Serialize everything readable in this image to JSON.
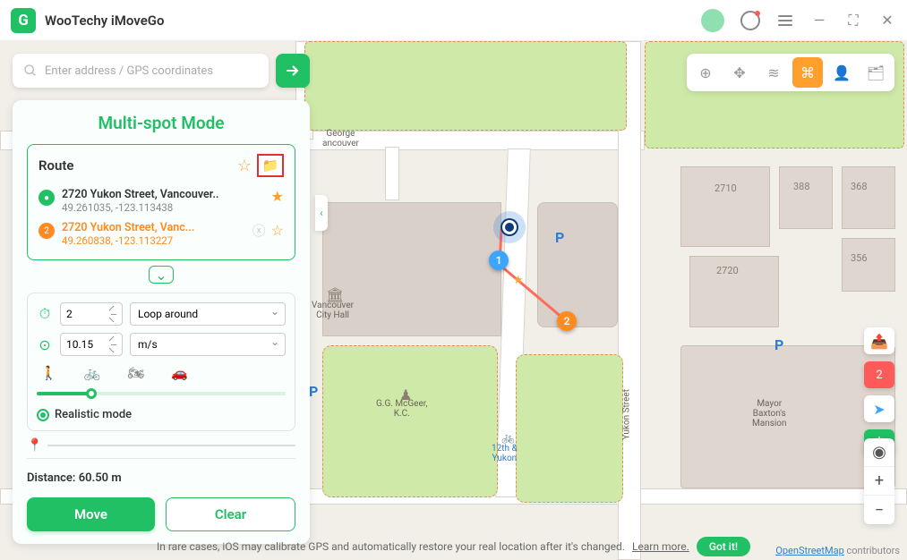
{
  "app": {
    "title": "WooTechy iMoveGo",
    "logo": "G"
  },
  "search": {
    "placeholder": "Enter address / GPS coordinates"
  },
  "mode": {
    "title": "Multi-spot Mode"
  },
  "route": {
    "label": "Route",
    "waypoints": [
      {
        "addr": "2720 Yukon Street, Vancouver..",
        "coord": "49.261035, -123.113438"
      },
      {
        "addr": "2720 Yukon Street, Vanc...",
        "coord": "49.260838, -123.113227"
      }
    ]
  },
  "controls": {
    "repeat": "2",
    "loop_label": "Loop around",
    "speed": "10.15",
    "unit": "m/s",
    "realistic": "Realistic mode"
  },
  "distance": {
    "label": "Distance: 60.50 m"
  },
  "buttons": {
    "move": "Move",
    "clear": "Clear"
  },
  "footer": {
    "text": "In rare cases, iOS may calibrate GPS and automatically restore your real location after it's changed.",
    "learn": "Learn more.",
    "gotit": "Got it!"
  },
  "attrib": {
    "osm": "OpenStreetMap",
    "tail": " contributors"
  },
  "waypoint_badge_2": "2",
  "map": {
    "labels": {
      "george": "George\nancouver",
      "cityhall": "Vancouver\nCity Hall",
      "mcgeer": "G.G. McGeer,\nK.C.",
      "yukon12": "12th &\nYukon",
      "baxton": "Mayor\nBaxton's\nMansion",
      "yukonst": "Yukon Street"
    },
    "bnums": {
      "a": "2710",
      "b": "388",
      "c": "368",
      "d": "356",
      "e": "2720"
    },
    "pins": {
      "p1": "1",
      "p2": "2"
    }
  }
}
